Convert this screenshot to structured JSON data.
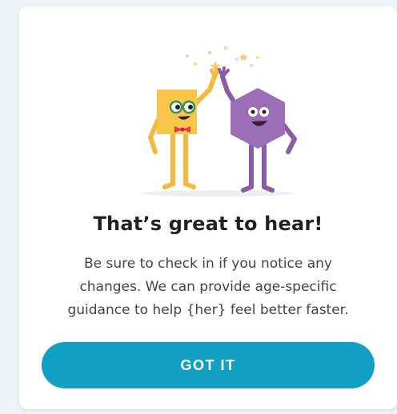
{
  "dialog": {
    "title": "That’s great to hear!",
    "message": "Be sure to check in if you notice any changes. We can provide age-specific guidance to help {her} feel better faster.",
    "button_label": "GOT IT"
  },
  "colors": {
    "accent": "#11a0c3",
    "square_character": "#f7c64a",
    "hexagon_character": "#9b6eb7",
    "title_text": "#1f2327",
    "body_text": "#3f4448"
  },
  "icons": {
    "illustration": "high-five-characters-illustration"
  }
}
